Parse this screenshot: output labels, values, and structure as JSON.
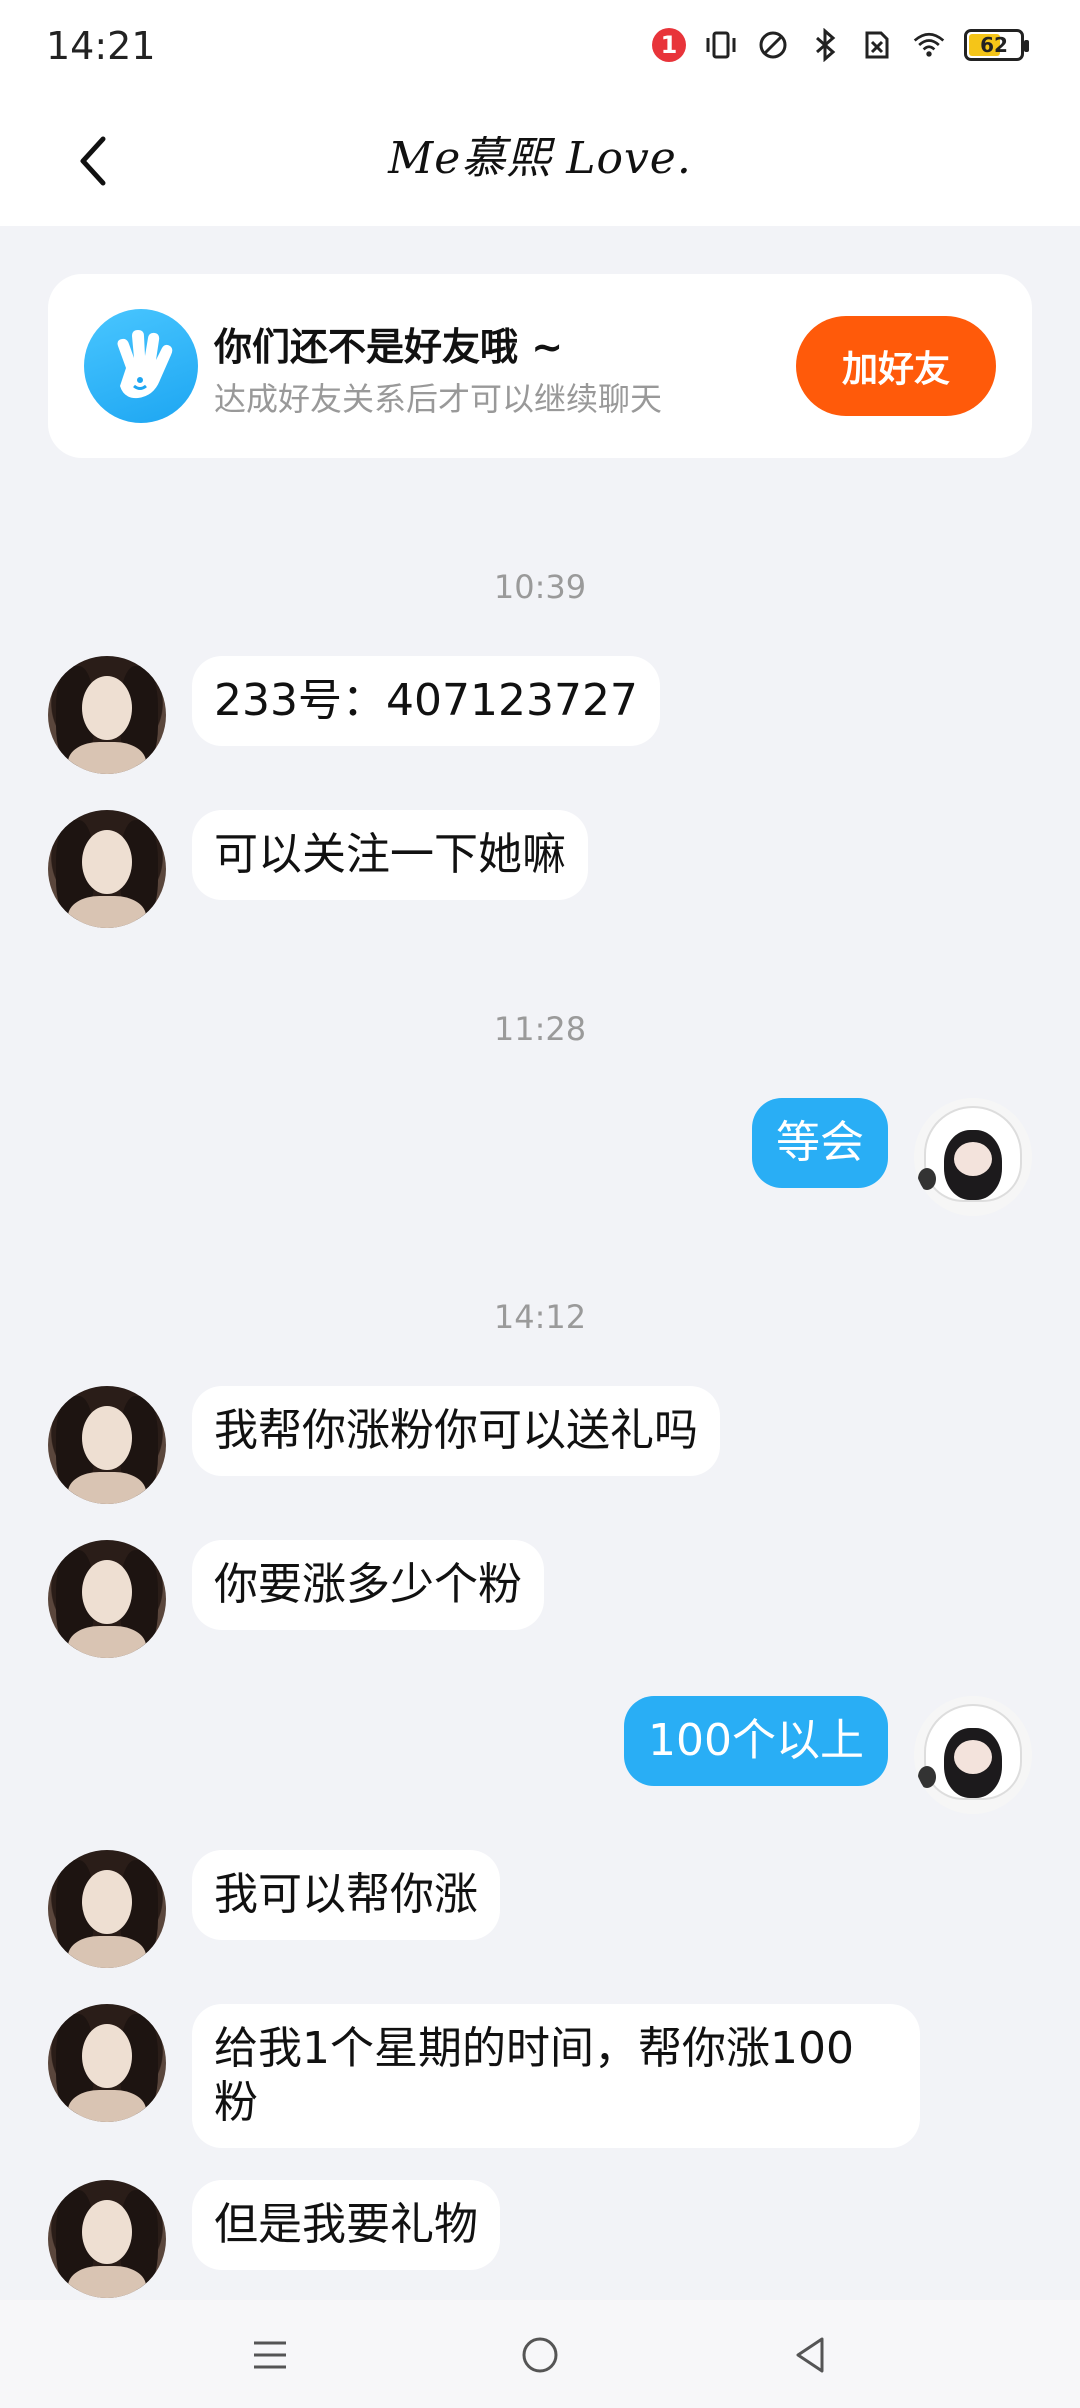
{
  "status_bar": {
    "time": "14:21",
    "notification_count": "1",
    "battery_level": "62",
    "battery_percent": 62,
    "icons": [
      "vibrate-icon",
      "do-not-disturb-icon",
      "bluetooth-icon",
      "no-sim-icon",
      "wifi-icon",
      "battery-icon"
    ]
  },
  "header": {
    "title": "Me慕熙 Love.",
    "back_icon": "chevron-left-icon"
  },
  "friend_banner": {
    "icon": "hand-wave-icon",
    "title": "你们还不是好友哦 ~",
    "subtitle": "达成好友关系后才可以继续聊天",
    "button_label": "加好友"
  },
  "timestamps": {
    "t1": "10:39",
    "t2": "11:28",
    "t3": "14:12"
  },
  "messages": [
    {
      "side": "left",
      "text": "233号：407123727"
    },
    {
      "side": "left",
      "text": "可以关注一下她嘛"
    },
    {
      "side": "right",
      "text": "等会"
    },
    {
      "side": "left",
      "text": "我帮你涨粉你可以送礼吗"
    },
    {
      "side": "left",
      "text": "你要涨多少个粉"
    },
    {
      "side": "right",
      "text": "100个以上"
    },
    {
      "side": "left",
      "text": "我可以帮你涨"
    },
    {
      "side": "left",
      "text": "给我1个星期的时间，帮你涨100\n粉"
    },
    {
      "side": "left",
      "text": "但是我要礼物"
    }
  ],
  "colors": {
    "accent_orange": "#ff5a0a",
    "bubble_blue": "#29aef5",
    "background": "#f2f3f7"
  },
  "nav_bar": {
    "icons": [
      "menu-icon",
      "home-circle-icon",
      "back-triangle-icon"
    ]
  }
}
